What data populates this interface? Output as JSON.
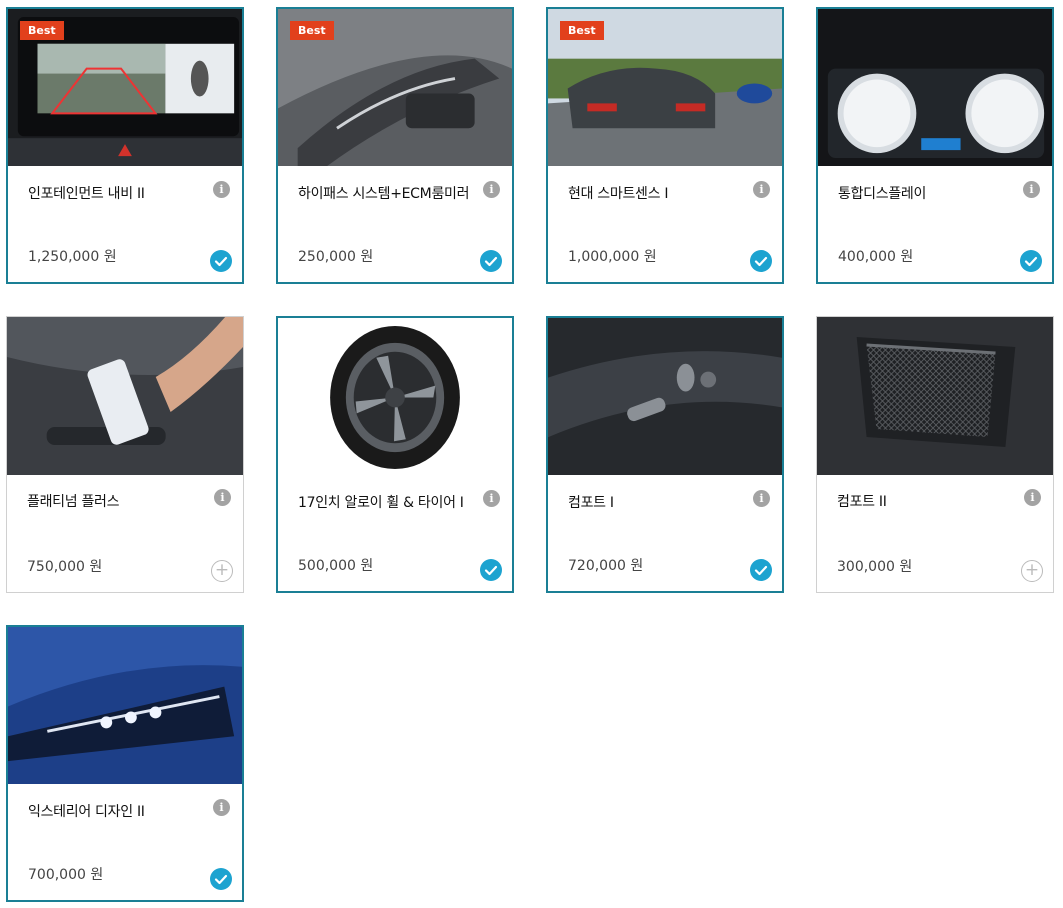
{
  "best_label": "Best",
  "info_glyph": "i",
  "options": [
    {
      "name": "인포테인먼트 내비 II",
      "price": "1,250,000 원",
      "best": true,
      "selected": true,
      "image": "infotainment-screen"
    },
    {
      "name": "하이패스 시스템+ECM룸미러",
      "price": "250,000 원",
      "best": true,
      "selected": true,
      "image": "mirror-hipass"
    },
    {
      "name": "현대 스마트센스 I",
      "price": "1,000,000 원",
      "best": true,
      "selected": true,
      "image": "car-on-road"
    },
    {
      "name": "통합디스플레이",
      "price": "400,000 원",
      "best": false,
      "selected": true,
      "image": "cluster-display"
    },
    {
      "name": "플래티넘 플러스",
      "price": "750,000 원",
      "best": false,
      "selected": false,
      "image": "phone-key"
    },
    {
      "name": "17인치 알로이 휠 & 타이어 I",
      "price": "500,000 원",
      "best": false,
      "selected": true,
      "image": "alloy-wheel"
    },
    {
      "name": "컴포트 I",
      "price": "720,000 원",
      "best": false,
      "selected": true,
      "image": "power-seat"
    },
    {
      "name": "컴포트 II",
      "price": "300,000 원",
      "best": false,
      "selected": false,
      "image": "seat-net"
    },
    {
      "name": "익스테리어 디자인 II",
      "price": "700,000 원",
      "best": false,
      "selected": true,
      "image": "led-headlamp"
    }
  ]
}
